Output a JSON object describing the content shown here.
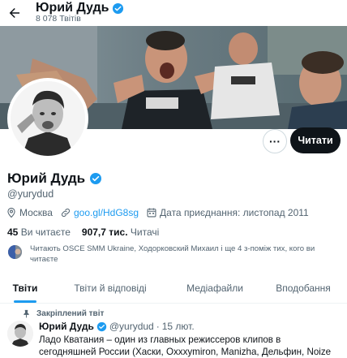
{
  "header": {
    "name": "Юрий Дудь",
    "tweet_count": "8 078 Твітів"
  },
  "profile": {
    "name": "Юрий Дудь",
    "handle": "@yurydud",
    "location": "Москва",
    "website": "goo.gl/HdG8sg",
    "joined": "Дата приєднання: листопад 2011",
    "following_count": "45",
    "following_label": "Ви читаєте",
    "followers_count": "907,7 тис.",
    "followers_label": "Читачі",
    "known_followers": "Читають OSCE SMM Ukraine, Ходорковский Михаил і ще 4 з-поміж тих, кого ви читаєте"
  },
  "actions": {
    "more_label": "···",
    "follow_label": "Читати"
  },
  "tabs": [
    {
      "label": "Твіти",
      "active": true
    },
    {
      "label": "Твіти й відповіді",
      "active": false
    },
    {
      "label": "Медіафайли",
      "active": false
    },
    {
      "label": "Вподобання",
      "active": false
    }
  ],
  "pinned_tweet": {
    "pinned_label": "Закріплений твіт",
    "author": "Юрий Дудь",
    "handle": "@yurydud",
    "separator": "·",
    "date": "15 лют.",
    "text": "Ладо Кватания – один из главных режиссеров клипов в сегодняшней России (Хаски, Oxxxymiron, Manizha, Дельфин, Noize MC). Съездили с"
  },
  "colors": {
    "accent": "#1d9bf0",
    "text": "#0f1419",
    "muted": "#536471",
    "follow_button_bg": "#0f1419"
  },
  "icons": [
    "back-arrow-icon",
    "verified-badge-icon",
    "location-icon",
    "link-icon",
    "calendar-icon",
    "pin-icon"
  ]
}
